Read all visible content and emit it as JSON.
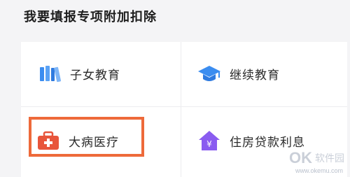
{
  "page": {
    "title": "我要填报专项附加扣除"
  },
  "items": [
    {
      "label": "子女教育",
      "icon": "books-icon"
    },
    {
      "label": "继续教育",
      "icon": "graduation-cap-icon"
    },
    {
      "label": "大病医疗",
      "icon": "medical-kit-icon"
    },
    {
      "label": "住房贷款利息",
      "icon": "house-yuan-icon"
    }
  ],
  "watermark": {
    "brand": "OK",
    "cn": "软件园",
    "url": "www.okemu.com"
  },
  "colors": {
    "highlight": "#ee6a3a",
    "accent_blue": "#3b8df0",
    "accent_purple": "#8a5cf0"
  }
}
